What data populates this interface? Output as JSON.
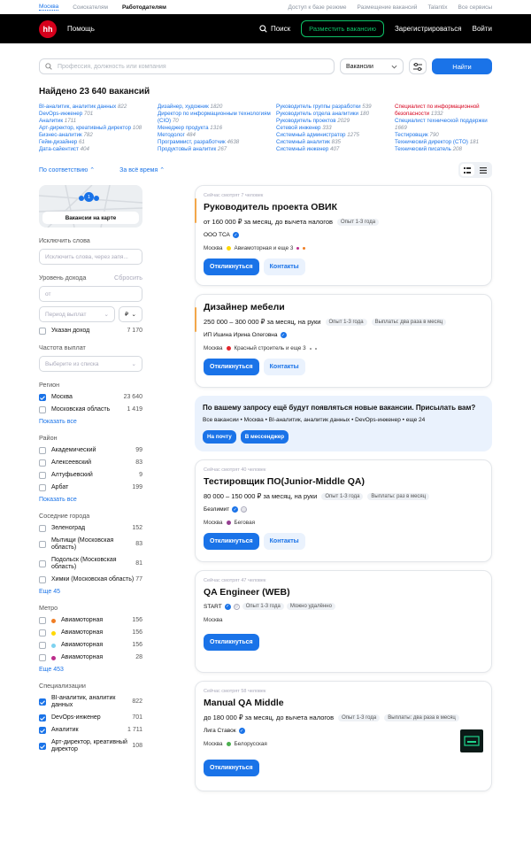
{
  "topbar": {
    "city": "Москва",
    "seekers": "Соискателям",
    "employers": "Работодателям",
    "right": [
      "Доступ к базе резюме",
      "Размещение вакансий",
      "Talantix",
      "Все сервисы"
    ]
  },
  "header": {
    "logo": "hh",
    "help": "Помощь",
    "search": "Поиск",
    "post": "Разместить вакансию",
    "register": "Зарегистрироваться",
    "login": "Войти"
  },
  "search": {
    "placeholder": "Профессия, должность или компания",
    "scope": "Вакансии",
    "button": "Найти"
  },
  "found": "Найдено 23 640 вакансий",
  "links": [
    [
      {
        "t": "BI-аналитик, аналитик данных",
        "c": "822"
      },
      {
        "t": "DevOps-инженер",
        "c": "701"
      },
      {
        "t": "Аналитик",
        "c": "1711"
      },
      {
        "t": "Арт-директор, креативный директор",
        "c": "108"
      },
      {
        "t": "Бизнес-аналитик",
        "c": "782"
      },
      {
        "t": "Гейм-дизайнер",
        "c": "61"
      },
      {
        "t": "Дата-сайентист",
        "c": "404"
      }
    ],
    [
      {
        "t": "Дизайнер, художник",
        "c": "1820"
      },
      {
        "t": "Директор по информационным технологиям (CIO)",
        "c": "70"
      },
      {
        "t": "Менеджер продукта",
        "c": "1316"
      },
      {
        "t": "Методолог",
        "c": "484"
      },
      {
        "t": "Программист, разработчик",
        "c": "4638"
      },
      {
        "t": "Продуктовый аналитик",
        "c": "267"
      }
    ],
    [
      {
        "t": "Руководитель группы разработки",
        "c": "539"
      },
      {
        "t": "Руководитель отдела аналитики",
        "c": "180"
      },
      {
        "t": "Руководитель проектов",
        "c": "2029"
      },
      {
        "t": "Сетевой инженер",
        "c": "333"
      },
      {
        "t": "Системный администратор",
        "c": "1275"
      },
      {
        "t": "Системный аналитик",
        "c": "835"
      },
      {
        "t": "Системный инженер",
        "c": "407"
      }
    ],
    [
      {
        "t": "Специалист по информационной безопасности",
        "c": "1332",
        "red": true
      },
      {
        "t": "Специалист технической поддержки",
        "c": "1669"
      },
      {
        "t": "Тестировщик",
        "c": "790"
      },
      {
        "t": "Технический директор (CTO)",
        "c": "181"
      },
      {
        "t": "Технический писатель",
        "c": "208"
      }
    ]
  ],
  "sort": {
    "order": "По соответствию",
    "period": "За всё время"
  },
  "sidebar": {
    "map_btn": "Вакансии на карте",
    "exclude_title": "Исключить слова",
    "exclude_placeholder": "Исключить слова, через запя...",
    "income_title": "Уровень дохода",
    "reset": "Сбросить",
    "income_from": "от",
    "period_placeholder": "Период выплат",
    "currency": "₽",
    "income_specified": {
      "l": "Указан доход",
      "c": "7 170"
    },
    "freq_title": "Частота выплат",
    "freq_placeholder": "Выберите из списка",
    "region_title": "Регион",
    "regions": [
      {
        "l": "Москва",
        "c": "23 640",
        "on": true
      },
      {
        "l": "Московская область",
        "c": "1 419",
        "on": false
      }
    ],
    "show_all": "Показать все",
    "district_title": "Район",
    "districts": [
      {
        "l": "Академический",
        "c": "99"
      },
      {
        "l": "Алексеевский",
        "c": "83"
      },
      {
        "l": "Алтуфьевский",
        "c": "9"
      },
      {
        "l": "Арбат",
        "c": "199"
      }
    ],
    "nearby_title": "Соседние города",
    "nearby": [
      {
        "l": "Зеленоград",
        "c": "152"
      },
      {
        "l": "Мытищи (Московская область)",
        "c": "83"
      },
      {
        "l": "Подольск (Московская область)",
        "c": "81"
      },
      {
        "l": "Химки (Московская область)",
        "c": "77"
      }
    ],
    "more45": "Еще 45",
    "metro_title": "Метро",
    "metro": [
      {
        "l": "Авиамоторная",
        "c": "156",
        "col": "#f07e24"
      },
      {
        "l": "Авиамоторная",
        "c": "156",
        "col": "#ffd803"
      },
      {
        "l": "Авиамоторная",
        "c": "156",
        "col": "#7ed2ef"
      },
      {
        "l": "Авиамоторная",
        "c": "28",
        "col": "#bc2d8b"
      }
    ],
    "more453": "Еще 453",
    "spec_title": "Специализации",
    "specs": [
      {
        "l": "BI-аналитик, аналитик данных",
        "c": "822"
      },
      {
        "l": "DevOps-инженер",
        "c": "701"
      },
      {
        "l": "Аналитик",
        "c": "1 711"
      },
      {
        "l": "Арт-директор, креативный директор",
        "c": "108"
      }
    ]
  },
  "cards": [
    {
      "views": "Сейчас смотрят 7 человек",
      "title": "Руководитель проекта ОВИК",
      "salary": "от 160 000 ₽ за месяц, до вычета налогов",
      "tags": [
        "Опыт 1-3 года"
      ],
      "company": "ООО ТСА",
      "loc": "Москва",
      "metro": "Авиамоторная и еще 3",
      "respond": "Откликнуться",
      "contacts": "Контакты"
    },
    {
      "views": "",
      "title": "Дизайнер мебели",
      "salary": "250 000 – 300 000 ₽ за месяц, на руки",
      "tags": [
        "Опыт 1-3 года",
        "Выплаты: два раза в месяц"
      ],
      "company": "ИП Ишина Ирина Олеговна",
      "loc": "Москва",
      "metro": "Красный строитель и еще 3",
      "respond": "Откликнуться",
      "contacts": "Контакты"
    },
    {
      "views": "Сейчас смотрят 40 человек",
      "title": "Тестировщик ПО(Junior-Middle QA)",
      "salary": "80 000 – 150 000 ₽ за месяц, на руки",
      "tags": [
        "Опыт 1-3 года",
        "Выплаты: раз в месяц"
      ],
      "company": "Безлимит",
      "loc": "Москва",
      "metro": "Беговая",
      "respond": "Откликнуться",
      "contacts": "Контакты"
    },
    {
      "views": "Сейчас смотрят 47 человек",
      "title": "QA Engineer (WEB)",
      "salary": "",
      "tags": [],
      "company": "START",
      "loc": "Москва",
      "metro": "",
      "respond": "Откликнуться",
      "contacts": ""
    },
    {
      "views": "Сейчас смотрят 58 человек",
      "title": "Manual QA Middle",
      "salary": "до 180 000 ₽ за месяц, до вычета налогов",
      "tags": [
        "Опыт 1-3 года",
        "Выплаты: два раза в месяц"
      ],
      "company": "Лига Ставок",
      "loc": "Москва",
      "metro": "Белорусская",
      "respond": "Откликнуться",
      "contacts": ""
    }
  ],
  "card4_tags": [
    "Опыт 1-3 года",
    "Можно удалённо"
  ],
  "notify": {
    "title": "По вашему запросу ещё будут появляться новые вакансии. Присылать вам?",
    "sub": "Все вакансии • Москва • BI-аналитик, аналитик данных • DevOps-инженер • еще 24",
    "mail": "На почту",
    "msg": "В мессенджер"
  }
}
